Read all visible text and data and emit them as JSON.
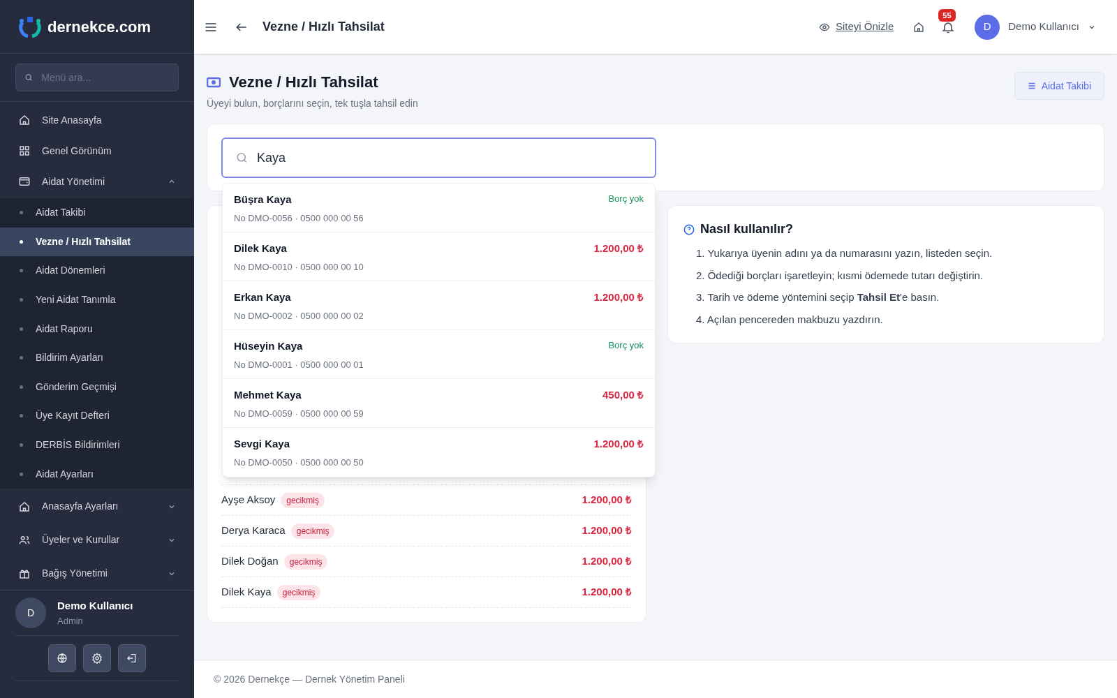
{
  "brand": "dernekce.com",
  "sidebar": {
    "search": {
      "placeholder": "Menü ara..."
    },
    "items": [
      {
        "label": "Site Anasayfa",
        "kind": "link",
        "selected": false
      },
      {
        "label": "Genel Görünüm",
        "kind": "link",
        "selected": false
      },
      {
        "label": "Aidat Yönetimi",
        "kind": "group",
        "expanded": true,
        "selected": false,
        "children": [
          {
            "label": "Aidat Takibi",
            "selected": false
          },
          {
            "label": "Vezne / Hızlı Tahsilat",
            "selected": true
          },
          {
            "label": "Aidat Dönemleri",
            "selected": false
          },
          {
            "label": "Yeni Aidat Tanımla",
            "selected": false
          },
          {
            "label": "Aidat Raporu",
            "selected": false
          },
          {
            "label": "Bildirim Ayarları",
            "selected": false
          },
          {
            "label": "Gönderim Geçmişi",
            "selected": false
          },
          {
            "label": "Üye Kayıt Defteri",
            "selected": false
          },
          {
            "label": "DERBİS Bildirimleri",
            "selected": false
          },
          {
            "label": "Aidat Ayarları",
            "selected": false
          }
        ]
      },
      {
        "label": "Anasayfa Ayarları",
        "kind": "group",
        "expanded": false,
        "selected": false
      },
      {
        "label": "Üyeler ve Kurullar",
        "kind": "group",
        "expanded": false,
        "selected": false
      },
      {
        "label": "Bağış Yönetimi",
        "kind": "group",
        "expanded": false,
        "selected": false
      }
    ],
    "user": {
      "avatar": "D",
      "name": "Demo Kullanıcı",
      "role": "Admin"
    }
  },
  "topbar": {
    "title": "Vezne / Hızlı Tahsilat",
    "preview_link": "Siteyi Önizle",
    "notification_count": "55",
    "user_avatar": "D",
    "user_name": "Demo Kullanıcı"
  },
  "page": {
    "title": "Vezne / Hızlı Tahsilat",
    "subtitle": "Üyeyi bulun, borçlarını seçin, tek tuşla tahsil edin",
    "action_button": "Aidat Takibi"
  },
  "search": {
    "value": "Kaya"
  },
  "results": [
    {
      "name": "Büşra Kaya",
      "detail": "No DMO-0056 · 0500 000 00 56",
      "kind": "clear",
      "amount": "Borç yok"
    },
    {
      "name": "Dilek Kaya",
      "detail": "No DMO-0010 · 0500 000 00 10",
      "kind": "debt",
      "amount": "1.200,00 ₺"
    },
    {
      "name": "Erkan Kaya",
      "detail": "No DMO-0002 · 0500 000 00 02",
      "kind": "debt",
      "amount": "1.200,00 ₺"
    },
    {
      "name": "Hüseyin Kaya",
      "detail": "No DMO-0001 · 0500 000 00 01",
      "kind": "clear",
      "amount": "Borç yok"
    },
    {
      "name": "Mehmet Kaya",
      "detail": "No DMO-0059 · 0500 000 00 59",
      "kind": "debt",
      "amount": "450,00 ₺"
    },
    {
      "name": "Sevgi Kaya",
      "detail": "No DMO-0050 · 0500 000 00 50",
      "kind": "debt",
      "amount": "1.200,00 ₺"
    }
  ],
  "debtors": [
    {
      "name": "Ayşe Aksoy",
      "status": "gecikmiş",
      "amount": "1.200,00 ₺"
    },
    {
      "name": "Derya Karaca",
      "status": "gecikmiş",
      "amount": "1.200,00 ₺"
    },
    {
      "name": "Dilek Doğan",
      "status": "gecikmiş",
      "amount": "1.200,00 ₺"
    },
    {
      "name": "Dilek Kaya",
      "status": "gecikmiş",
      "amount": "1.200,00 ₺"
    }
  ],
  "help": {
    "title": "Nasıl kullanılır?",
    "steps": [
      "1. Yukarıya üyenin adını ya da numarasını yazın, listeden seçin.",
      "2. Ödediği borçları işaretleyin; kısmi ödemede tutarı değiştirin.",
      "3. Tarih ve ödeme yöntemini seçip **Tahsil Et**'e basın.",
      "4. Açılan pencereden makbuzu yazdırın."
    ]
  },
  "footer": "© 2026 Dernekçe — Dernek Yönetim Paneli"
}
